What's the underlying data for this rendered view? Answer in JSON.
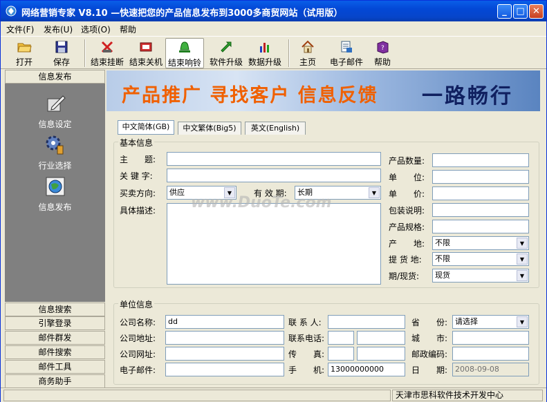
{
  "titlebar": {
    "title": "网络营销专家 V8.10 —快速把您的产品信息发布到3000多商贸网站（试用版）"
  },
  "menu": [
    {
      "label": "文件(F)"
    },
    {
      "label": "发布(U)"
    },
    {
      "label": "选项(O)"
    },
    {
      "label": "帮助"
    }
  ],
  "toolbar": [
    {
      "label": "打开",
      "icon": "open-folder-icon"
    },
    {
      "label": "保存",
      "icon": "save-disk-icon"
    },
    {
      "label": "结束挂断",
      "icon": "hangup-icon"
    },
    {
      "label": "结束关机",
      "icon": "shutdown-icon"
    },
    {
      "label": "结束响铃",
      "icon": "bell-icon"
    },
    {
      "label": "软件升级",
      "icon": "upgrade-icon"
    },
    {
      "label": "数据升级",
      "icon": "chart-icon"
    },
    {
      "label": "主页",
      "icon": "home-icon"
    },
    {
      "label": "电子邮件",
      "icon": "email-icon"
    },
    {
      "label": "帮助",
      "icon": "help-book-icon"
    }
  ],
  "sidebar": {
    "header": "信息发布",
    "items": [
      {
        "label": "信息设定",
        "icon": "settings-pen-icon"
      },
      {
        "label": "行业选择",
        "icon": "gear-icon"
      },
      {
        "label": "信息发布",
        "icon": "globe-icon"
      }
    ],
    "sections": [
      "信息搜索",
      "引擎登录",
      "邮件群发",
      "邮件搜索",
      "邮件工具",
      "商务助手"
    ]
  },
  "banner": {
    "slogan": "产品推广  寻找客户  信息反馈",
    "tagline": "一路畅行"
  },
  "tabs": [
    "中文简体(GB)",
    "中文繁体(Big5)",
    "英文(English)"
  ],
  "basic": {
    "title": "基本信息",
    "subject": "主　　题:",
    "keyword": "关 键 字:",
    "direction": "买卖方向:",
    "direction_value": "供应",
    "validity": "有 效 期:",
    "validity_value": "长期",
    "desc": "具体描述:",
    "qty": "产品数量:",
    "unit": "单　　位:",
    "price": "单　　价:",
    "pack": "包装说明:",
    "spec": "产品规格:",
    "origin": "产　　地:",
    "origin_value": "不限",
    "delivery": "提 货 地:",
    "delivery_value": "不限",
    "term": "期/现货:",
    "term_value": "现货"
  },
  "company": {
    "title": "单位信息",
    "name": "公司名称:",
    "name_value": "dd",
    "address": "公司地址:",
    "website": "公司网址:",
    "email": "电子邮件:",
    "contact": "联 系 人:",
    "phone": "联系电话:",
    "fax": "传　　真:",
    "mobile": "手　　机:",
    "mobile_value": "13000000000",
    "province": "省　　份:",
    "province_value": "请选择",
    "city": "城　　市:",
    "zip": "邮政编码:",
    "date": "日　　期:",
    "date_value": "2008-09-08"
  },
  "status": {
    "company": "天津市思科软件技术开发中心"
  },
  "watermark": "www.DuoTe.com"
}
